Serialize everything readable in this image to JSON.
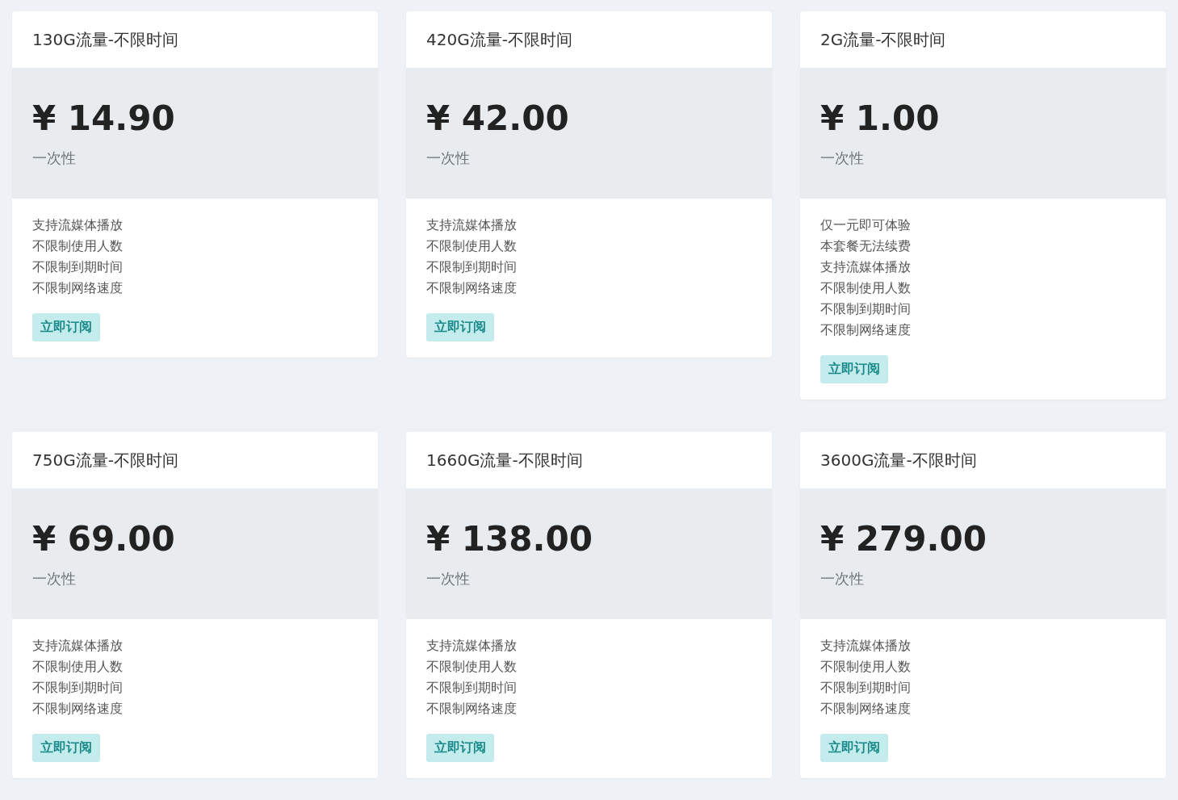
{
  "plans": [
    {
      "title": "130G流量-不限时间",
      "price": "¥ 14.90",
      "period": "一次性",
      "features": [
        "支持流媒体播放",
        "不限制使用人数",
        "不限制到期时间",
        "不限制网络速度"
      ],
      "button": "立即订阅"
    },
    {
      "title": "420G流量-不限时间",
      "price": "¥ 42.00",
      "period": "一次性",
      "features": [
        "支持流媒体播放",
        "不限制使用人数",
        "不限制到期时间",
        "不限制网络速度"
      ],
      "button": "立即订阅"
    },
    {
      "title": "2G流量-不限时间",
      "price": "¥ 1.00",
      "period": "一次性",
      "features": [
        "仅一元即可体验",
        "本套餐无法续费",
        "支持流媒体播放",
        "不限制使用人数",
        "不限制到期时间",
        "不限制网络速度"
      ],
      "button": "立即订阅"
    },
    {
      "title": "750G流量-不限时间",
      "price": "¥ 69.00",
      "period": "一次性",
      "features": [
        "支持流媒体播放",
        "不限制使用人数",
        "不限制到期时间",
        "不限制网络速度"
      ],
      "button": "立即订阅"
    },
    {
      "title": "1660G流量-不限时间",
      "price": "¥ 138.00",
      "period": "一次性",
      "features": [
        "支持流媒体播放",
        "不限制使用人数",
        "不限制到期时间",
        "不限制网络速度"
      ],
      "button": "立即订阅"
    },
    {
      "title": "3600G流量-不限时间",
      "price": "¥ 279.00",
      "period": "一次性",
      "features": [
        "支持流媒体播放",
        "不限制使用人数",
        "不限制到期时间",
        "不限制网络速度"
      ],
      "button": "立即订阅"
    }
  ]
}
